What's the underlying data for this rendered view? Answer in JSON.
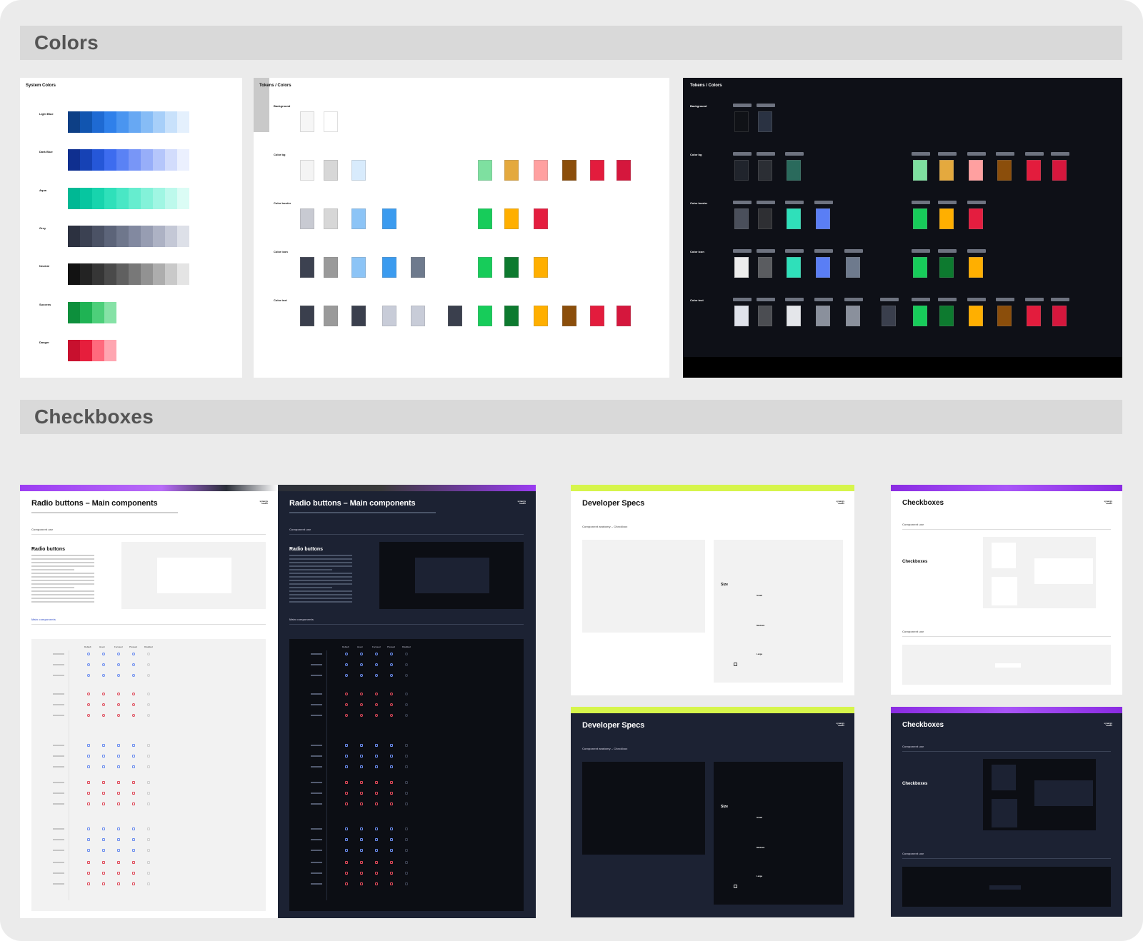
{
  "sections": {
    "colors_title": "Colors",
    "checkboxes_title": "Checkboxes"
  },
  "system_colors": {
    "title": "System Colors",
    "rows": [
      {
        "label": "Light Blue",
        "colors": [
          "#0d3f85",
          "#1155b0",
          "#1e6ad3",
          "#2f80ea",
          "#4a95f0",
          "#67a8f3",
          "#86bcf6",
          "#a7cff9",
          "#c8e1fb",
          "#e4f0fd"
        ]
      },
      {
        "label": "Dark Blue",
        "colors": [
          "#0f2f8f",
          "#1642b5",
          "#2557d8",
          "#3d6cef",
          "#5a82f5",
          "#7896f7",
          "#97aef9",
          "#b5c6fb",
          "#d2dcfc",
          "#ebf0fe"
        ]
      },
      {
        "label": "Aqua",
        "colors": [
          "#00b894",
          "#06c6a0",
          "#17d4ad",
          "#2fe0ba",
          "#49e7c5",
          "#66edcf",
          "#83f2d9",
          "#a0f6e3",
          "#bdf9ec",
          "#dbfcf5"
        ]
      },
      {
        "label": "Grey",
        "colors": [
          "#2c3140",
          "#3b4152",
          "#4b5265",
          "#5c6479",
          "#6f778c",
          "#8289a0",
          "#979db2",
          "#adb2c4",
          "#c4c8d6",
          "#dde0e8"
        ]
      },
      {
        "label": "Neutral",
        "colors": [
          "#121212",
          "#232323",
          "#363636",
          "#4a4a4a",
          "#606060",
          "#787878",
          "#929292",
          "#adadad",
          "#c9c9c9",
          "#e4e4e4"
        ]
      },
      {
        "label": "Success",
        "colors": [
          "#0d8f3c",
          "#1fb354",
          "#4dcf7a",
          "#86e2a6"
        ]
      },
      {
        "label": "Danger",
        "colors": [
          "#c8102e",
          "#e61e3c",
          "#ff6a7d",
          "#ffa6b1"
        ]
      }
    ]
  },
  "tokens_light": {
    "title": "Tokens / Colors",
    "rows": [
      {
        "label": "Background",
        "left": [
          "#f6f6f6",
          "#ffffff"
        ],
        "right": []
      },
      {
        "label": "Color bg",
        "left": [
          "#f4f4f4",
          "#d7d7d7",
          "#d8ebfc"
        ],
        "right": [
          "#7ee0a0",
          "#e4a93e",
          "#ffa0a0",
          "#8b4e0b",
          "#e31c3d",
          "#d5173d"
        ]
      },
      {
        "label": "Color border",
        "left": [
          "#c8cad2",
          "#d7d7d7",
          "#8cc4f6",
          "#3b9bef"
        ],
        "right": [
          "#17cc5a",
          "#ffaf00",
          "#e41d3f"
        ]
      },
      {
        "label": "Color icon",
        "left": [
          "#3c4150",
          "#9a9a9a",
          "#8cc4f6",
          "#3b9bef",
          "#6e7a8d"
        ],
        "right": [
          "#17cc5a",
          "#0d7a2f",
          "#ffaf00"
        ]
      },
      {
        "label": "Color text",
        "left": [
          "#3a3f4d",
          "#9a9a9a",
          "#3a3f4d",
          "#c8ccd8",
          "#c8ccd8",
          "#3a3f4d"
        ],
        "right": [
          "#17cc5a",
          "#0d7a2f",
          "#ffaf00",
          "#8b4e0b",
          "#e31c3d",
          "#d5173d"
        ]
      }
    ]
  },
  "tokens_dark": {
    "title": "Tokens / Colors",
    "rows": [
      {
        "label": "Background",
        "left": [
          "#101217",
          "#2a3242"
        ],
        "right": []
      },
      {
        "label": "Color bg",
        "left": [
          "#20242c",
          "#2b2e34",
          "#2a6a5c"
        ],
        "right": [
          "#7ee0a0",
          "#e4a93e",
          "#ffa0a0",
          "#8b4e0b",
          "#e31c3d",
          "#d5173d"
        ]
      },
      {
        "label": "Color border",
        "left": [
          "#4a4f5b",
          "#2e2f33",
          "#2fe0ba",
          "#5a7ef5"
        ],
        "right": [
          "#17cc5a",
          "#ffaf00",
          "#e41d3f"
        ]
      },
      {
        "label": "Color icon",
        "left": [
          "#ededed",
          "#5a5c60",
          "#2fe0ba",
          "#5a7ef5",
          "#6e7a8d"
        ],
        "right": [
          "#17cc5a",
          "#0d7a2f",
          "#ffaf00"
        ]
      },
      {
        "label": "Color text",
        "left": [
          "#dfe2ea",
          "#4b4d52",
          "#e4e6ea",
          "#8a909c",
          "#8a909c",
          "#3a3f4d"
        ],
        "right": [
          "#17cc5a",
          "#0d7a2f",
          "#ffaf00",
          "#8b4e0b",
          "#e31c3d",
          "#d5173d"
        ]
      }
    ]
  },
  "docs": {
    "radio_light": {
      "title": "Radio buttons – Main components",
      "logo": "synergy studio",
      "usage": "Component use",
      "heading": "Radio buttons",
      "main": "Main components"
    },
    "radio_dark": {
      "title": "Radio buttons – Main components",
      "logo": "synergy studio",
      "usage": "Component use",
      "heading": "Radio buttons",
      "main": "Main components"
    },
    "dev_light": {
      "title": "Developer Specs",
      "logo": "synergy studio",
      "anatomy": "Component anatomy – Checkbox",
      "size": "Size",
      "small": "Small",
      "medium": "Medium",
      "large": "Large"
    },
    "dev_dark": {
      "title": "Developer Specs",
      "logo": "synergy studio",
      "anatomy": "Component anatomy – Checkbox",
      "size": "Size",
      "small": "Small",
      "medium": "Medium",
      "large": "Large"
    },
    "cb_light": {
      "title": "Checkboxes",
      "logo": "synergy studio",
      "usage": "Component use",
      "heading": "Checkboxes",
      "usage2": "Component use"
    },
    "cb_dark": {
      "title": "Checkboxes",
      "logo": "synergy studio",
      "usage": "Component use",
      "heading": "Checkboxes",
      "usage2": "Component use"
    }
  },
  "radio_table": {
    "headers": [
      "Default",
      "Hover",
      "Focused",
      "Pressed",
      "Disabled"
    ],
    "rows": [
      "Checkbox",
      "Unselected",
      "Indeterminate",
      "Selected",
      "Unselected",
      "Indeterminate",
      "Selected"
    ]
  },
  "accent": {
    "purple": "#9b3cf2",
    "lime": "#d6f54b",
    "navy": "#1c2233",
    "black": "#0c0e14"
  }
}
